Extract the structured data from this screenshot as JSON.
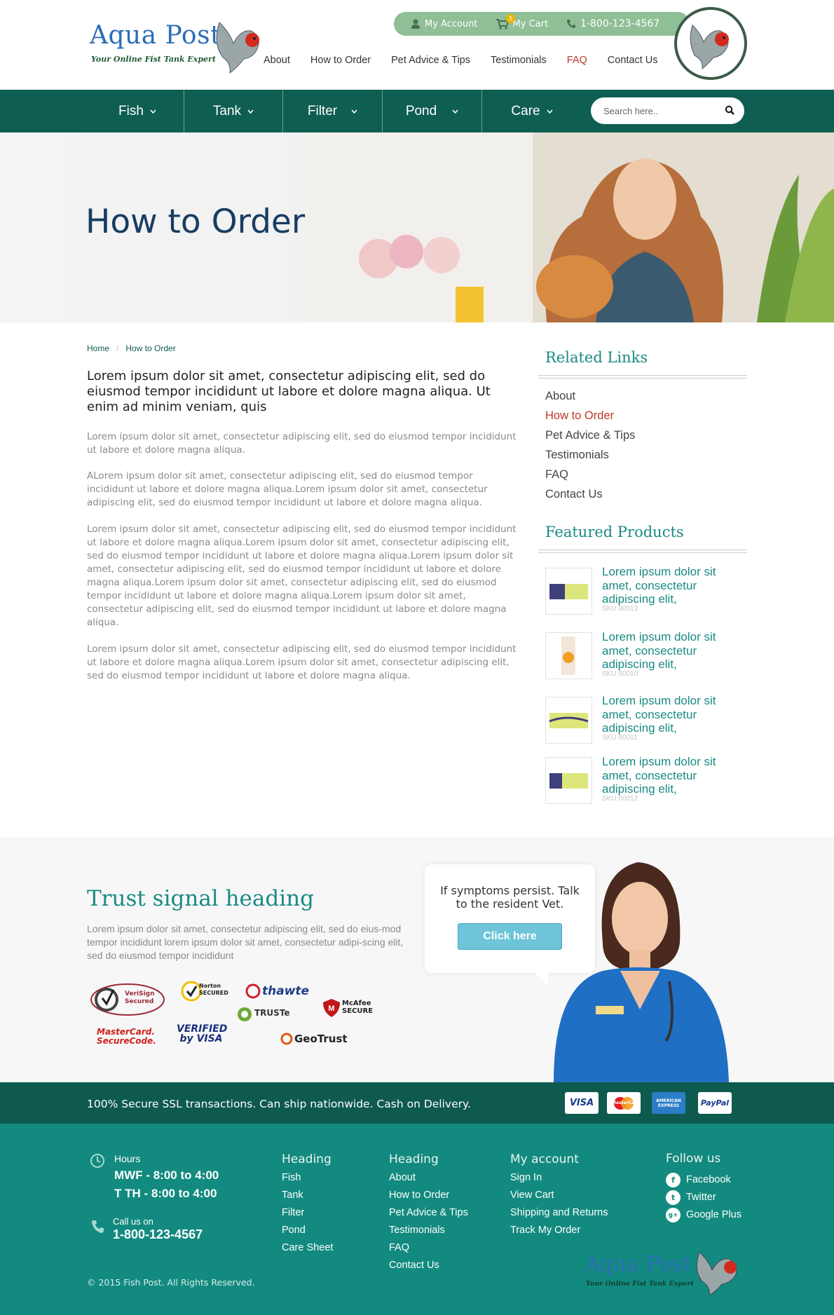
{
  "header": {
    "logo_title": "Aqua Post",
    "logo_tagline": "Your Online Fist Tank Expert",
    "topbar": {
      "account": "My Account",
      "cart": "My Cart",
      "cart_count": "3",
      "phone": "1-800-123-4567"
    },
    "nav": [
      "About",
      "How to Order",
      "Pet Advice & Tips",
      "Testimonials",
      "FAQ",
      "Contact Us"
    ],
    "nav_active": "FAQ"
  },
  "mainnav": {
    "items": [
      "Fish",
      "Tank",
      "Filter",
      "Pond",
      "Care"
    ],
    "search_placeholder": "Search here.."
  },
  "hero": {
    "title": "How to Order"
  },
  "breadcrumb": [
    "Home",
    "How to Order"
  ],
  "content": {
    "lead": "Lorem ipsum dolor sit amet, consectetur adipiscing elit, sed do eiusmod tempor incididunt ut labore et dolore magna aliqua. Ut enim ad minim veniam, quis",
    "paragraphs": [
      "Lorem ipsum dolor sit amet, consectetur adipiscing elit, sed do eiusmod tempor incididunt ut labore et dolore magna aliqua.",
      "ALorem ipsum dolor sit amet, consectetur adipiscing elit, sed do eiusmod tempor incididunt ut labore et dolore magna aliqua.Lorem ipsum dolor sit amet, consectetur adipiscing elit, sed do eiusmod tempor incididunt ut labore et dolore magna aliqua.",
      "Lorem ipsum dolor sit amet, consectetur adipiscing elit, sed do eiusmod tempor incididunt ut labore et dolore magna aliqua.Lorem ipsum dolor sit amet, consectetur adipiscing elit, sed do eiusmod tempor incididunt ut labore et dolore magna aliqua.Lorem ipsum dolor sit amet, consectetur adipiscing elit, sed do eiusmod tempor incididunt ut labore et dolore magna aliqua.Lorem ipsum dolor sit amet, consectetur adipiscing elit, sed do eiusmod tempor incididunt ut labore et dolore magna aliqua.Lorem ipsum dolor sit amet, consectetur adipiscing elit, sed do eiusmod tempor incididunt ut labore et dolore magna aliqua.",
      "Lorem ipsum dolor sit amet, consectetur adipiscing elit, sed do eiusmod tempor incididunt ut labore et dolore magna aliqua.Lorem ipsum dolor sit amet, consectetur adipiscing elit, sed do eiusmod tempor incididunt ut labore et dolore magna aliqua."
    ]
  },
  "sidebar": {
    "related_heading": "Related Links",
    "related_links": [
      "About",
      "How to Order",
      "Pet Advice & Tips",
      "Testimonials",
      "FAQ",
      "Contact Us"
    ],
    "related_active": "How to Order",
    "featured_heading": "Featured Products",
    "products": [
      {
        "title": "Lorem ipsum dolor sit amet, consectetur adipiscing elit,",
        "sku": "SKU 00013"
      },
      {
        "title": "Lorem ipsum dolor sit amet, consectetur adipiscing elit,",
        "sku": "SKU 00010"
      },
      {
        "title": "Lorem ipsum dolor sit amet, consectetur adipiscing elit,",
        "sku": "SKU 00011"
      },
      {
        "title": "Lorem ipsum dolor sit amet, consectetur adipiscing elit,",
        "sku": "SKU 00012"
      }
    ]
  },
  "trust": {
    "heading": "Trust signal heading",
    "text": "Lorem ipsum dolor sit amet, consectetur adipiscing elit, sed do eius-mod tempor incididunt lorem ipsum dolor sit amet, consectetur adipi-scing elit, sed do eiusmod tempor incididunt",
    "badges": [
      "VeriSign Secured",
      "Norton SECURED",
      "thawte",
      "TRUSTe",
      "McAfee SECURE",
      "MasterCard. SecureCode.",
      "VERIFIED by VISA",
      "GeoTrust"
    ],
    "bubble_text": "If symptoms persist. Talk to the resident Vet.",
    "cta": "Click here"
  },
  "ssl_bar": {
    "text": "100% Secure SSL transactions. Can ship nationwide. Cash on Delivery.",
    "cards": [
      "VISA",
      "MasterCard",
      "AMERICAN EXPRESS",
      "PayPal"
    ]
  },
  "footer": {
    "hours_label": "Hours",
    "hours_line1": "MWF - 8:00 to 4:00",
    "hours_line2": "T TH - 8:00 to 4:00",
    "call_label": "Call us on",
    "call_number": "1-800-123-4567",
    "col1_heading": "Heading",
    "col1_links": [
      "Fish",
      "Tank",
      "Filter",
      "Pond",
      "Care Sheet"
    ],
    "col2_heading": "Heading",
    "col2_links": [
      "About",
      "How to Order",
      "Pet Advice & Tips",
      "Testimonials",
      "FAQ",
      "Contact Us"
    ],
    "col3_heading": "My account",
    "col3_links": [
      "Sign In",
      "View Cart",
      "Shipping and Returns",
      "Track My Order"
    ],
    "follow_heading": "Follow us",
    "social": [
      "Facebook",
      "Twitter",
      "Google Plus"
    ],
    "copyright": "© 2015 Fish Post. All Rights Reserved.",
    "logo_title": "Aqua Post",
    "logo_tagline": "Your Online Fist Tank Expert"
  },
  "colors": {
    "primary": "#0f5e52",
    "accent": "#1a8a83",
    "footer": "#138a7f",
    "active": "#c0392b",
    "hero_title": "#173d63"
  }
}
